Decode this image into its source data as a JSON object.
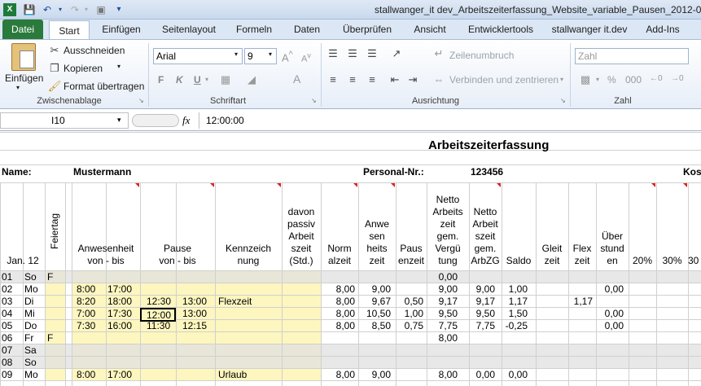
{
  "window": {
    "title": "stallwanger_it dev_Arbeitszeiterfassung_Website_variable_Pausen_2012-08"
  },
  "tabs": [
    "Datei",
    "Start",
    "Einfügen",
    "Seitenlayout",
    "Formeln",
    "Daten",
    "Überprüfen",
    "Ansicht",
    "Entwicklertools",
    "stallwanger it.dev",
    "Add-Ins"
  ],
  "ribbon": {
    "clipboard": {
      "paste": "Einfügen",
      "cut": "Ausschneiden",
      "copy": "Kopieren",
      "format": "Format übertragen",
      "label": "Zwischenablage"
    },
    "font": {
      "name": "Arial",
      "size": "9",
      "label": "Schriftart",
      "bold": "F",
      "italic": "K",
      "underline": "U"
    },
    "alignment": {
      "wrap": "Zeilenumbruch",
      "merge": "Verbinden und zentrieren",
      "label": "Ausrichtung"
    },
    "number": {
      "format": "Zahl",
      "label": "Zahl",
      "percent": "%",
      "thousands": "000"
    }
  },
  "formula_bar": {
    "name_box": "I10",
    "fx": "fx",
    "value": "12:00:00"
  },
  "sheet": {
    "title": "Arbeitszeiterfassung",
    "name_label": "Name:",
    "name_value": "Mustermann",
    "pers_label": "Personal-Nr.:",
    "pers_value": "123456",
    "kos_label": "Kos",
    "headers": {
      "month": "Jan. 12",
      "feiertag": "Feiertag",
      "anwesenheit": "Anwesenheit\nvon - bis",
      "pause": "Pause\nvon - bis",
      "kennzeichnung": "Kennzeich\nnung",
      "passiv": "davon\npassiv\nArbeit\nszeit\n(Std.)",
      "norm": "Norm\nalzeit",
      "anwesenheitszeit": "Anwe\nsen\nheits\nzeit",
      "pausenzeit": "Paus\nenzeit",
      "netto_verg": "Netto\nArbeits\nzeit\ngem.\nVergü\ntung",
      "netto_arbzg": "Netto\nArbeit\nszeit\ngem.\nArbZG",
      "saldo": "Saldo",
      "gleit": "Gleit\nzeit",
      "flex": "Flex\nzeit",
      "ueber": "Über\nstund\nen",
      "p20": "20%",
      "p30": "30%",
      "p30b": "30"
    },
    "rows": [
      {
        "d": "01",
        "w": "So",
        "f": "F",
        "a1": "",
        "a2": "",
        "p1": "",
        "p2": "",
        "k": "",
        "n": "",
        "az": "",
        "pz": "",
        "nv": "0,00",
        "na": "",
        "s": "",
        "fl": "",
        "u": ""
      },
      {
        "d": "02",
        "w": "Mo",
        "f": "",
        "a1": "8:00",
        "a2": "17:00",
        "p1": "",
        "p2": "",
        "k": "",
        "n": "8,00",
        "az": "9,00",
        "pz": "",
        "nv": "9,00",
        "na": "9,00",
        "s": "1,00",
        "fl": "",
        "u": "0,00"
      },
      {
        "d": "03",
        "w": "Di",
        "f": "",
        "a1": "8:20",
        "a2": "18:00",
        "p1": "12:30",
        "p2": "13:00",
        "k": "Flexzeit",
        "n": "8,00",
        "az": "9,67",
        "pz": "0,50",
        "nv": "9,17",
        "na": "9,17",
        "s": "1,17",
        "fl": "1,17",
        "u": ""
      },
      {
        "d": "04",
        "w": "Mi",
        "f": "",
        "a1": "7:00",
        "a2": "17:30",
        "p1": "12:00",
        "p2": "13:00",
        "k": "",
        "n": "8,00",
        "az": "10,50",
        "pz": "1,00",
        "nv": "9,50",
        "na": "9,50",
        "s": "1,50",
        "fl": "",
        "u": "0,00"
      },
      {
        "d": "05",
        "w": "Do",
        "f": "",
        "a1": "7:30",
        "a2": "16:00",
        "p1": "11:30",
        "p2": "12:15",
        "k": "",
        "n": "8,00",
        "az": "8,50",
        "pz": "0,75",
        "nv": "7,75",
        "na": "7,75",
        "s": "-0,25",
        "fl": "",
        "u": "0,00"
      },
      {
        "d": "06",
        "w": "Fr",
        "f": "F",
        "a1": "",
        "a2": "",
        "p1": "",
        "p2": "",
        "k": "",
        "n": "",
        "az": "",
        "pz": "",
        "nv": "8,00",
        "na": "",
        "s": "",
        "fl": "",
        "u": ""
      },
      {
        "d": "07",
        "w": "Sa",
        "f": "",
        "a1": "",
        "a2": "",
        "p1": "",
        "p2": "",
        "k": "",
        "n": "",
        "az": "",
        "pz": "",
        "nv": "",
        "na": "",
        "s": "",
        "fl": "",
        "u": ""
      },
      {
        "d": "08",
        "w": "So",
        "f": "",
        "a1": "",
        "a2": "",
        "p1": "",
        "p2": "",
        "k": "",
        "n": "",
        "az": "",
        "pz": "",
        "nv": "",
        "na": "",
        "s": "",
        "fl": "",
        "u": ""
      },
      {
        "d": "09",
        "w": "Mo",
        "f": "",
        "a1": "8:00",
        "a2": "17:00",
        "p1": "",
        "p2": "",
        "k": "Urlaub",
        "n": "8,00",
        "az": "9,00",
        "pz": "",
        "nv": "8,00",
        "na": "0,00",
        "s": "0,00",
        "fl": "",
        "u": ""
      }
    ]
  }
}
